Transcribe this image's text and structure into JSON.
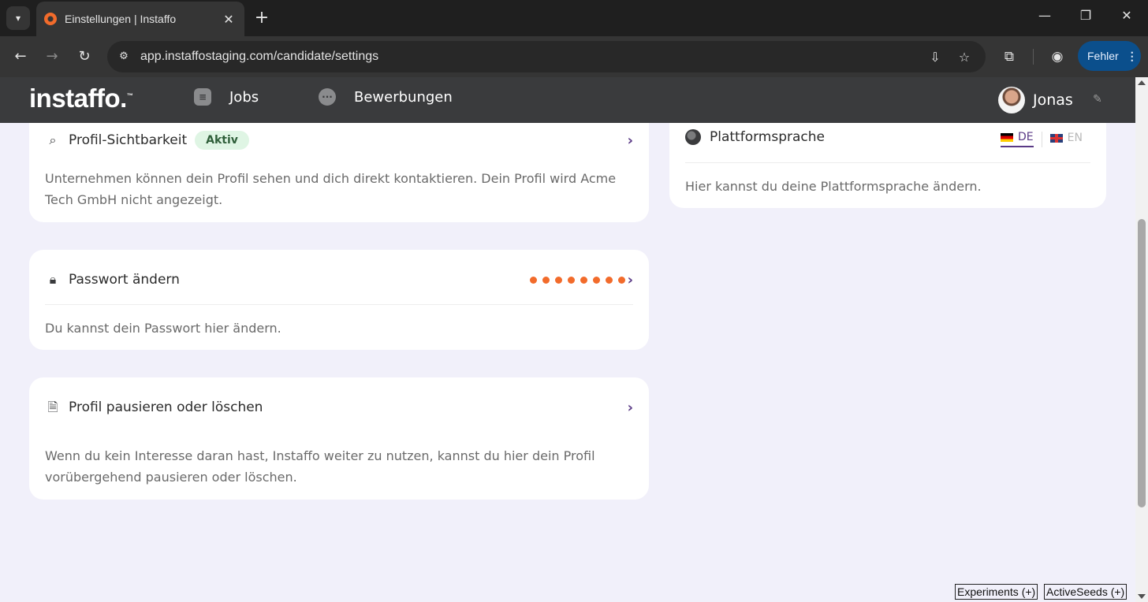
{
  "browser": {
    "tab_title": "Einstellungen | Instaffo",
    "tab_close": "✕",
    "new_tab": "+",
    "url": "app.instaffostaging.com/candidate/settings",
    "profile_button_label": "Fehler",
    "window_controls": [
      "minimize-icon",
      "restore-icon",
      "close-icon"
    ]
  },
  "header": {
    "logo": "instaffo.",
    "nav": [
      {
        "label": "Jobs",
        "icon": "list-icon"
      },
      {
        "label": "Bewerbungen",
        "icon": "chat-bubble-icon"
      }
    ],
    "user_name": "Jonas"
  },
  "cards": {
    "visibility": {
      "title": "Profil-Sichtbarkeit",
      "badge": "Aktiv",
      "description": "Unternehmen können dein Profil sehen und dich direkt kontaktieren. Dein Profil wird Acme Tech GmbH nicht angezeigt."
    },
    "password": {
      "title": "Passwort ändern",
      "dots": 8,
      "description": "Du kannst dein Passwort hier ändern."
    },
    "pause_delete": {
      "title": "Profil pausieren oder löschen",
      "description": "Wenn du kein Interesse daran hast, Instaffo weiter zu nutzen, kannst du hier dein Profil vorübergehend pausieren oder löschen."
    },
    "language": {
      "title": "Plattformsprache",
      "options": [
        {
          "code": "DE",
          "active": true
        },
        {
          "code": "EN",
          "active": false
        }
      ],
      "description": "Hier kannst du deine Plattformsprache ändern."
    }
  },
  "debug": {
    "experiments": "Experiments (+)",
    "active_seeds": "ActiveSeeds (+)"
  },
  "colors": {
    "accent": "#5a3a86",
    "password_dots": "#f26b2b",
    "badge_bg": "#dff5e4",
    "header_bg": "#3a3b3d",
    "page_bg": "#f1f0fa"
  }
}
